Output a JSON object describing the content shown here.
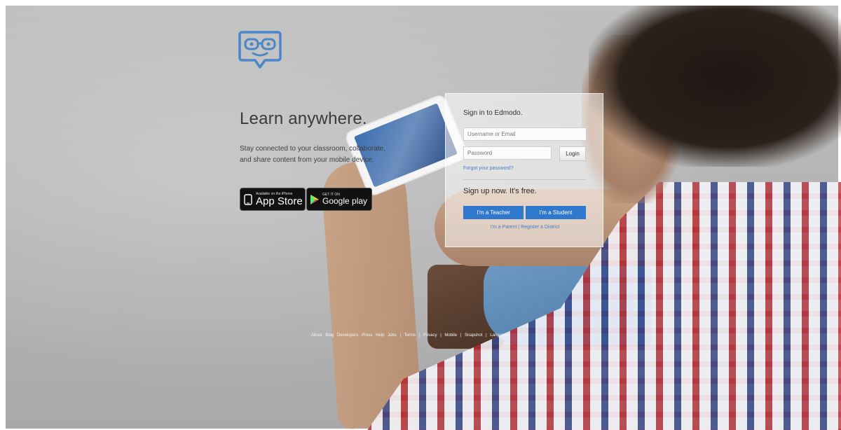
{
  "hero": {
    "headline": "Learn anywhere.",
    "description": "Stay connected to your classroom, collaborate, and share content from your mobile device."
  },
  "stores": {
    "app_store": {
      "small": "Available on the iPhone",
      "label": "App Store",
      "icon": "apple-icon"
    },
    "google_play": {
      "small": "GET IT ON",
      "label": "Google play",
      "icon": "play-icon"
    }
  },
  "signin": {
    "title": "Sign in to Edmodo.",
    "username_placeholder": "Username or Email",
    "password_placeholder": "Password",
    "login_label": "Login",
    "forgot_label": "Forgot your password?",
    "signup_title": "Sign up now. It's free.",
    "teacher_label": "I'm a Teacher",
    "student_label": "I'm a Student",
    "links": [
      "I'm a Parent",
      "|",
      "Register a District"
    ]
  },
  "footer": {
    "links": [
      "About",
      "Blog",
      "Developers",
      "Press",
      "Help",
      "Jobs",
      "|",
      "Terms",
      "|",
      "Privacy",
      "|",
      "Mobile",
      "|",
      "Snapshot",
      "|",
      "Language"
    ]
  },
  "colors": {
    "accent": "#2f78cc",
    "logo": "#4a86c8"
  }
}
